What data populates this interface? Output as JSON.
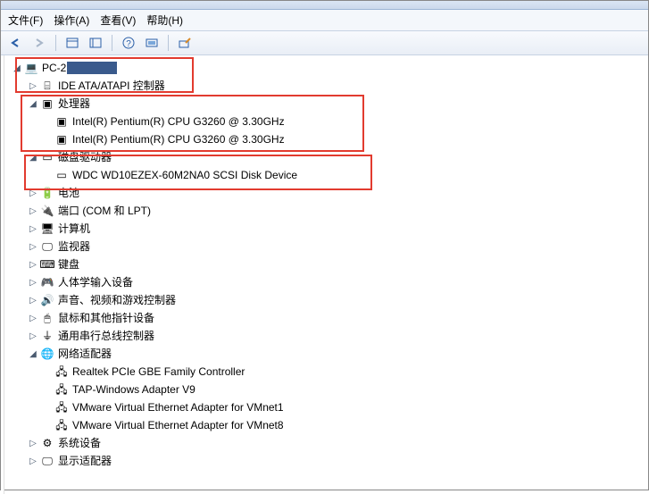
{
  "menu": {
    "file": "文件(F)",
    "action": "操作(A)",
    "view": "查看(V)",
    "help": "帮助(H)"
  },
  "toolbar": {
    "back": "back",
    "forward": "forward",
    "panel1": "panel",
    "panel2": "panel",
    "help": "help",
    "monitor": "monitor",
    "scan": "scan"
  },
  "tree": {
    "root": "PC-2",
    "rootMasked": "▃▃▃▃▃▃",
    "ide": "IDE ATA/ATAPI 控制器",
    "cpu": "处理器",
    "cpu_item": "Intel(R) Pentium(R) CPU G3260 @ 3.30GHz",
    "disk": "磁盘驱动器",
    "disk_item": "WDC WD10EZEX-60M2NA0 SCSI Disk Device",
    "battery": "电池",
    "ports": "端口 (COM 和 LPT)",
    "computer": "计算机",
    "monitor": "监视器",
    "keyboard": "键盘",
    "hid": "人体学输入设备",
    "sound": "声音、视频和游戏控制器",
    "mouse": "鼠标和其他指针设备",
    "usb": "通用串行总线控制器",
    "net": "网络适配器",
    "net1": "Realtek PCIe GBE Family Controller",
    "net2": "TAP-Windows Adapter V9",
    "net3": "VMware Virtual Ethernet Adapter for VMnet1",
    "net4": "VMware Virtual Ethernet Adapter for VMnet8",
    "system": "系统设备",
    "display": "显示适配器"
  },
  "glyphs": {
    "expand": "▷",
    "collapse": "◢",
    "pc": "💻",
    "chip": "▣",
    "cpu": "▣",
    "disk": "▭",
    "hdd": "⌸",
    "battery": "🔋",
    "port": "🔌",
    "computer": "🖥",
    "monitor": "🖵",
    "keyboard": "⌨",
    "hid": "🎮",
    "sound": "🔊",
    "mouse": "🖱",
    "usb": "⏚",
    "net": "🌐",
    "nic": "🖧",
    "system": "⚙",
    "display": "🖵"
  }
}
